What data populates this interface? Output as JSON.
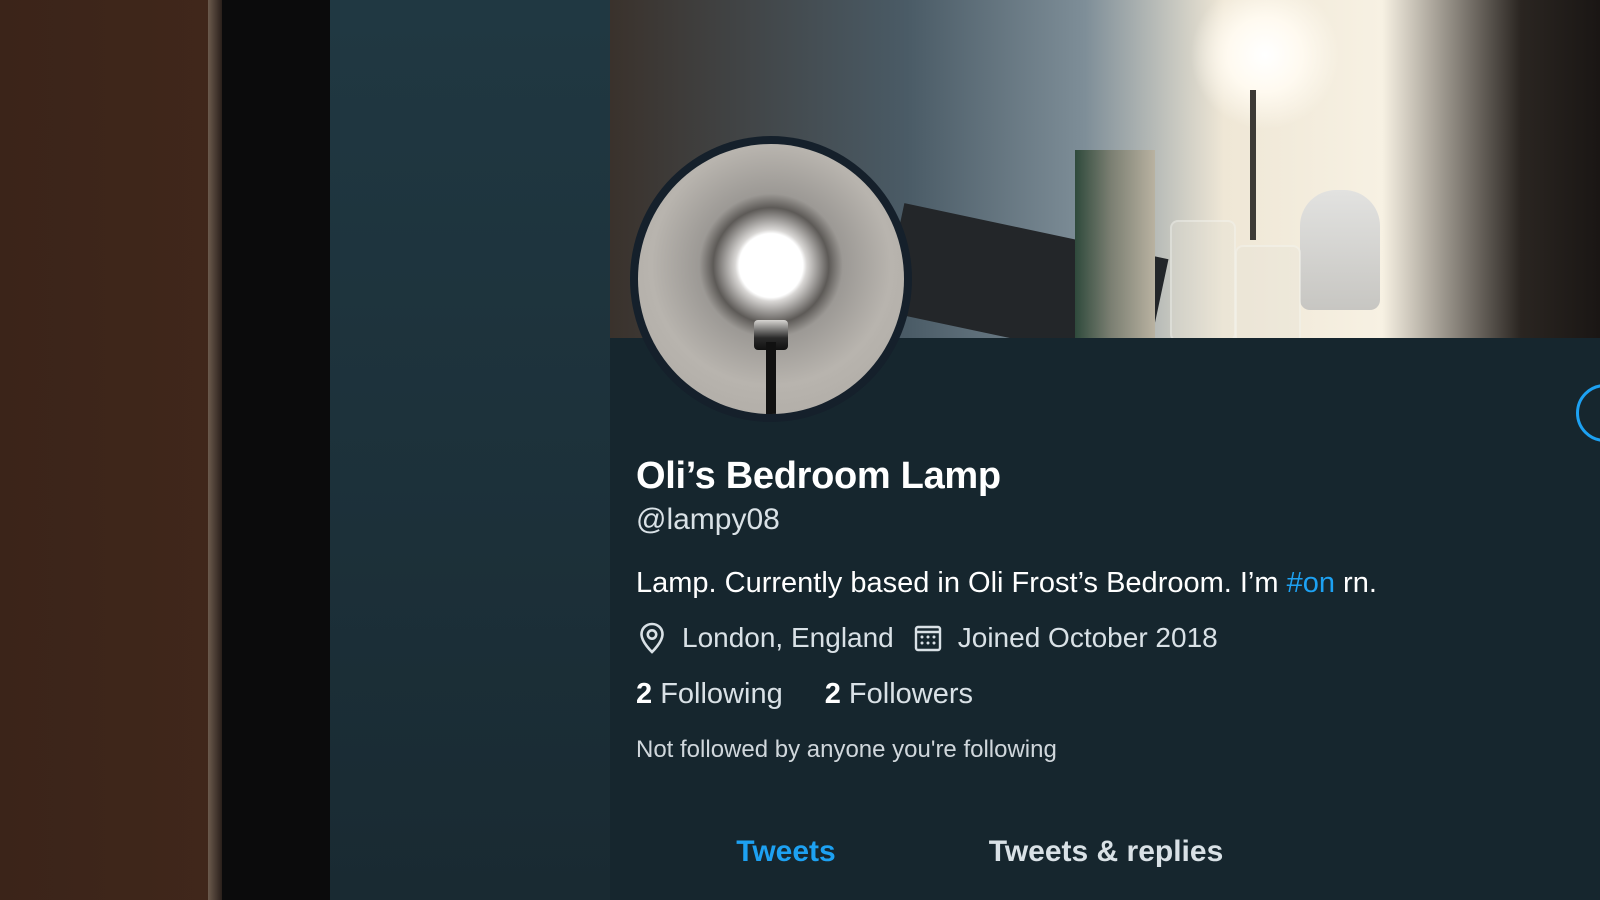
{
  "profile": {
    "display_name": "Oli’s Bedroom Lamp",
    "handle": "@lampy08",
    "bio_before_hashtag": "Lamp. Currently based in Oli Frost’s Bedroom. I’m ",
    "bio_hashtag": "#on",
    "bio_after_hashtag": " rn.",
    "location": "London, England",
    "joined": "Joined October 2018",
    "location_icon": "location-pin-icon",
    "joined_icon": "calendar-icon",
    "following_count": "2",
    "following_label": "Following",
    "followers_count": "2",
    "followers_label": "Followers",
    "social_context": "Not followed by anyone you're following"
  },
  "tabs": [
    {
      "label": "Tweets",
      "active": true
    },
    {
      "label": "Tweets & replies",
      "active": false
    }
  ],
  "colors": {
    "accent": "#1da1f2",
    "background": "#15202b",
    "text": "#ffffff",
    "secondary_text": "#d9e1e6"
  }
}
